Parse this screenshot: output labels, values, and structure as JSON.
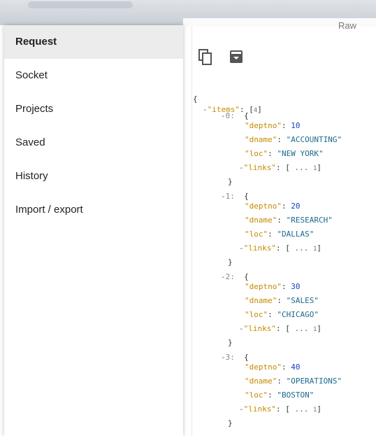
{
  "header": {
    "raw_label": "Raw"
  },
  "drawer": {
    "items": [
      {
        "label": "Request",
        "active": true
      },
      {
        "label": "Socket"
      },
      {
        "label": "Projects"
      },
      {
        "label": "Saved"
      },
      {
        "label": "History"
      },
      {
        "label": "Import / export"
      }
    ]
  },
  "toolbar": {
    "copy_icon": "copy-icon",
    "save_icon": "save-icon"
  },
  "json_view": {
    "root_key": "items",
    "items_count": "4",
    "entries": [
      {
        "index": "0",
        "deptno": "10",
        "dname": "ACCOUNTING",
        "loc": "NEW YORK",
        "links_count": "1"
      },
      {
        "index": "1",
        "deptno": "20",
        "dname": "RESEARCH",
        "loc": "DALLAS",
        "links_count": "1"
      },
      {
        "index": "2",
        "deptno": "30",
        "dname": "SALES",
        "loc": "CHICAGO",
        "links_count": "1"
      },
      {
        "index": "3",
        "deptno": "40",
        "dname": "OPERATIONS",
        "loc": "BOSTON",
        "links_count": "1"
      }
    ]
  }
}
